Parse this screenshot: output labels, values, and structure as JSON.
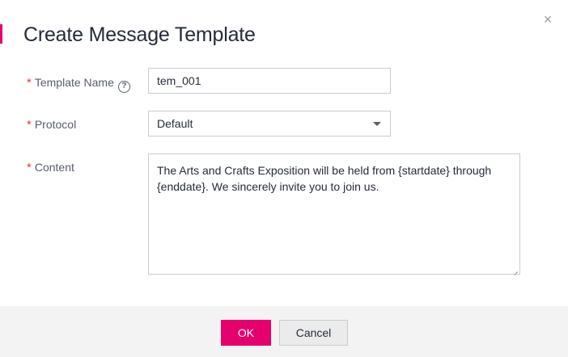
{
  "dialog": {
    "title": "Create Message Template",
    "close_symbol": "×"
  },
  "form": {
    "required_mark": "*",
    "template_name": {
      "label": "Template Name",
      "help_symbol": "?",
      "value": "tem_001"
    },
    "protocol": {
      "label": "Protocol",
      "value": "Default"
    },
    "content": {
      "label": "Content",
      "value": "The Arts and Crafts Exposition will be held from {startdate} through {enddate}. We sincerely invite you to join us."
    }
  },
  "footer": {
    "ok_label": "OK",
    "cancel_label": "Cancel"
  },
  "colors": {
    "accent": "#e6006e",
    "required": "#e23c3c",
    "footer_bg": "#f3f3f3"
  },
  "icons": {
    "close": "close-icon",
    "help": "help-circle-icon",
    "dropdown": "chevron-down-icon",
    "resize": "resize-grip-icon"
  }
}
